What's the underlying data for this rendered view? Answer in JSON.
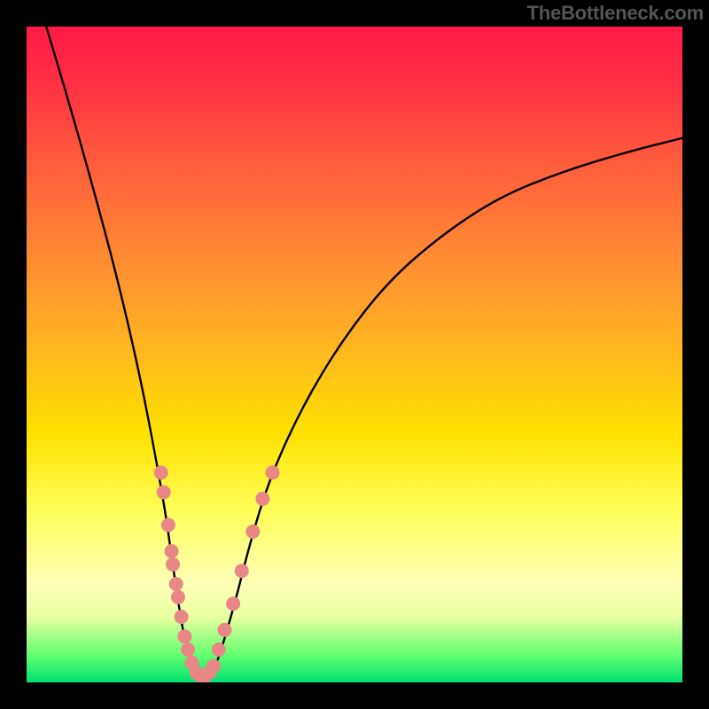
{
  "watermark": "TheBottleneck.com",
  "colors": {
    "background": "#000000",
    "gradient_top": "#ff1a47",
    "gradient_bottom": "#00e070",
    "curve_stroke": "#000000",
    "dot_fill": "#e98787"
  },
  "chart_data": {
    "type": "line",
    "title": "",
    "xlabel": "",
    "ylabel": "",
    "xlim": [
      0,
      100
    ],
    "ylim": [
      0,
      100
    ],
    "note": "V-shaped bottleneck curve; y ≈ bottleneck percentage (high=red, low=green). Minimum (optimal) near x≈25–28 where y≈0. Salmon dots mark data samples clustered on both flanks below y≈35.",
    "curve_points": [
      {
        "x": 3,
        "y": 100
      },
      {
        "x": 6,
        "y": 90
      },
      {
        "x": 10,
        "y": 76
      },
      {
        "x": 14,
        "y": 61
      },
      {
        "x": 17,
        "y": 48
      },
      {
        "x": 19,
        "y": 38
      },
      {
        "x": 21,
        "y": 27
      },
      {
        "x": 22,
        "y": 20
      },
      {
        "x": 23,
        "y": 13
      },
      {
        "x": 24,
        "y": 7
      },
      {
        "x": 25,
        "y": 3
      },
      {
        "x": 26,
        "y": 1
      },
      {
        "x": 27,
        "y": 0
      },
      {
        "x": 28,
        "y": 1
      },
      {
        "x": 29,
        "y": 3
      },
      {
        "x": 30,
        "y": 6
      },
      {
        "x": 32,
        "y": 13
      },
      {
        "x": 34,
        "y": 21
      },
      {
        "x": 37,
        "y": 31
      },
      {
        "x": 42,
        "y": 42
      },
      {
        "x": 48,
        "y": 52
      },
      {
        "x": 55,
        "y": 61
      },
      {
        "x": 63,
        "y": 68
      },
      {
        "x": 72,
        "y": 74
      },
      {
        "x": 82,
        "y": 78
      },
      {
        "x": 92,
        "y": 81
      },
      {
        "x": 100,
        "y": 83
      }
    ],
    "dots": [
      {
        "x": 20.5,
        "y": 32
      },
      {
        "x": 20.9,
        "y": 29
      },
      {
        "x": 21.6,
        "y": 24
      },
      {
        "x": 22.1,
        "y": 20
      },
      {
        "x": 22.3,
        "y": 18
      },
      {
        "x": 22.8,
        "y": 15
      },
      {
        "x": 23.1,
        "y": 13
      },
      {
        "x": 23.6,
        "y": 10
      },
      {
        "x": 24.1,
        "y": 7
      },
      {
        "x": 24.6,
        "y": 5
      },
      {
        "x": 25.2,
        "y": 3
      },
      {
        "x": 25.9,
        "y": 1.5
      },
      {
        "x": 26.5,
        "y": 1
      },
      {
        "x": 27.2,
        "y": 1
      },
      {
        "x": 27.9,
        "y": 1.5
      },
      {
        "x": 28.5,
        "y": 2.5
      },
      {
        "x": 29.3,
        "y": 5
      },
      {
        "x": 30.2,
        "y": 8
      },
      {
        "x": 31.5,
        "y": 12
      },
      {
        "x": 32.8,
        "y": 17
      },
      {
        "x": 34.5,
        "y": 23
      },
      {
        "x": 36.0,
        "y": 28
      },
      {
        "x": 37.5,
        "y": 32
      }
    ],
    "dot_radius": 8
  }
}
